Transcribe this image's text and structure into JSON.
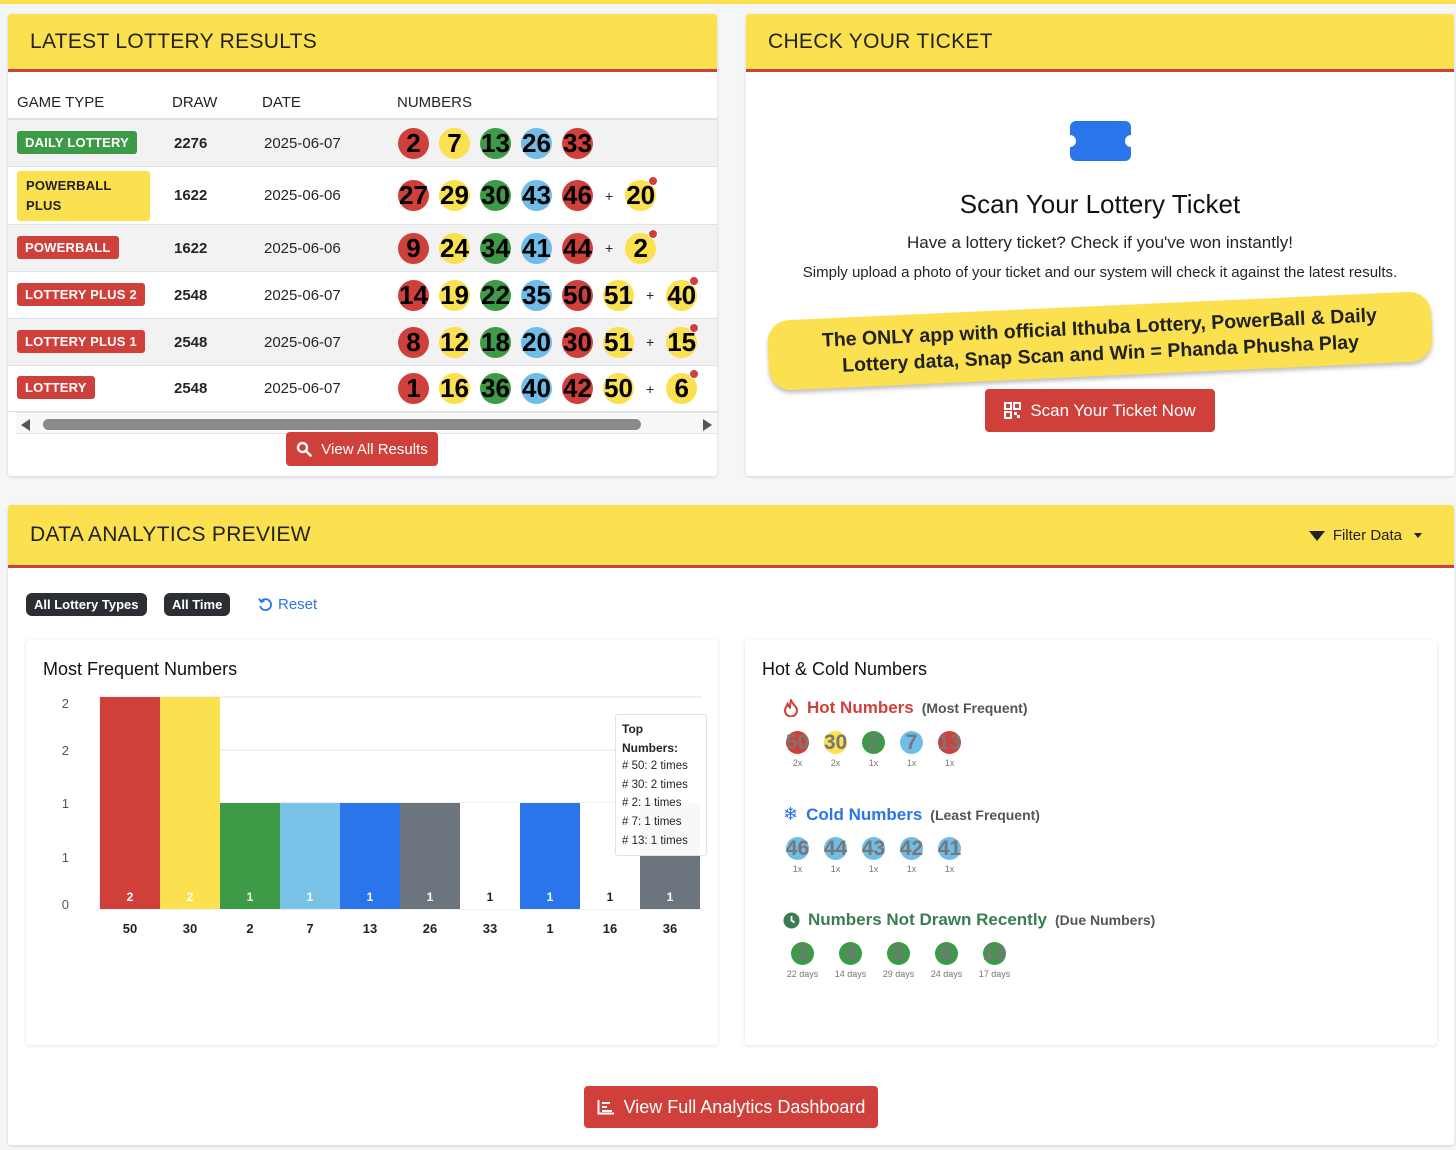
{
  "results": {
    "title": "LATEST LOTTERY RESULTS",
    "columns": [
      "GAME TYPE",
      "DRAW",
      "DATE",
      "NUMBERS"
    ],
    "rows": [
      {
        "game": "DAILY LOTTERY",
        "badge_color": "#3d9a47",
        "draw": "2276",
        "date": "2025-06-07",
        "numbers": [
          "2",
          "7",
          "13",
          "26",
          "33"
        ],
        "colors": [
          "red",
          "yellow",
          "green",
          "blue",
          "red"
        ],
        "bonus": ""
      },
      {
        "game": "POWERBALL PLUS",
        "badge_color": "#fbe04f",
        "draw": "1622",
        "date": "2025-06-06",
        "numbers": [
          "27",
          "29",
          "30",
          "43",
          "46"
        ],
        "colors": [
          "red",
          "yellow",
          "green",
          "blue",
          "red"
        ],
        "bonus": "20"
      },
      {
        "game": "POWERBALL",
        "badge_color": "#d0403a",
        "draw": "1622",
        "date": "2025-06-06",
        "numbers": [
          "9",
          "24",
          "34",
          "41",
          "44"
        ],
        "colors": [
          "red",
          "yellow",
          "green",
          "blue",
          "red"
        ],
        "bonus": "2"
      },
      {
        "game": "LOTTERY PLUS 2",
        "badge_color": "#d0403a",
        "draw": "2548",
        "date": "2025-06-07",
        "numbers": [
          "14",
          "19",
          "22",
          "35",
          "50",
          "51"
        ],
        "colors": [
          "red",
          "yellow",
          "green",
          "blue",
          "red",
          "yellow"
        ],
        "bonus": "40"
      },
      {
        "game": "LOTTERY PLUS 1",
        "badge_color": "#d0403a",
        "draw": "2548",
        "date": "2025-06-07",
        "numbers": [
          "8",
          "12",
          "18",
          "20",
          "30",
          "51"
        ],
        "colors": [
          "red",
          "yellow",
          "green",
          "blue",
          "red",
          "yellow"
        ],
        "bonus": "15"
      },
      {
        "game": "LOTTERY",
        "badge_color": "#d0403a",
        "draw": "2548",
        "date": "2025-06-07",
        "numbers": [
          "1",
          "16",
          "36",
          "40",
          "42",
          "50"
        ],
        "colors": [
          "red",
          "yellow",
          "green",
          "blue",
          "red",
          "yellow"
        ],
        "bonus": "6"
      }
    ],
    "plus_sign": "+",
    "view_all_label": "View All Results"
  },
  "ticket": {
    "title": "CHECK YOUR TICKET",
    "heading": "Scan Your Lottery Ticket",
    "subtitle": "Have a lottery ticket? Check if you've won instantly!",
    "note": "Simply upload a photo of your ticket and our system will check it against the latest results.",
    "banner": "The ONLY app with official Ithuba Lottery, PowerBall & Daily Lottery data, Snap Scan and Win = Phanda Phusha Play",
    "scan_button": "Scan Your Ticket Now"
  },
  "analytics": {
    "title": "DATA ANALYTICS PREVIEW",
    "filter_label": "Filter Data",
    "filters": [
      "All Lottery Types",
      "All Time"
    ],
    "reset_label": "Reset",
    "most_frequent_title": "Most Frequent Numbers",
    "hot_cold_title": "Hot & Cold Numbers",
    "hot": {
      "label": "Hot Numbers",
      "note": "(Most Frequent)",
      "color": "#d0403a",
      "items": [
        {
          "n": "50",
          "c": "red",
          "t": "2x"
        },
        {
          "n": "30",
          "c": "yellow",
          "t": "2x"
        },
        {
          "n": "2",
          "c": "green",
          "t": "1x"
        },
        {
          "n": "7",
          "c": "blue",
          "t": "1x"
        },
        {
          "n": "13",
          "c": "red",
          "t": "1x"
        }
      ]
    },
    "cold": {
      "label": "Cold Numbers",
      "note": "(Least Frequent)",
      "color": "#2a75ea",
      "items": [
        {
          "n": "46",
          "c": "blue",
          "t": "1x"
        },
        {
          "n": "44",
          "c": "blue",
          "t": "1x"
        },
        {
          "n": "43",
          "c": "blue",
          "t": "1x"
        },
        {
          "n": "42",
          "c": "blue",
          "t": "1x"
        },
        {
          "n": "41",
          "c": "blue",
          "t": "1x"
        }
      ]
    },
    "due": {
      "label": "Numbers Not Drawn Recently",
      "note": "(Due Numbers)",
      "color": "#3a7d52",
      "items": [
        {
          "n": "3",
          "c": "green",
          "t": "22 days"
        },
        {
          "n": "4",
          "c": "green",
          "t": "14 days"
        },
        {
          "n": "5",
          "c": "green",
          "t": "29 days"
        },
        {
          "n": "6",
          "c": "green",
          "t": "24 days"
        },
        {
          "n": "10",
          "c": "green",
          "t": "17 days"
        }
      ]
    },
    "tooltip": {
      "title": "Top Numbers:",
      "lines": [
        "# 50: 2 times",
        "# 30: 2 times",
        "# 2: 1 times",
        "# 7: 1 times",
        "# 13: 1 times"
      ]
    },
    "dashboard_button": "View Full Analytics Dashboard"
  },
  "chart_data": {
    "type": "bar",
    "title": "Most Frequent Numbers",
    "categories": [
      "50",
      "30",
      "2",
      "7",
      "13",
      "26",
      "33",
      "1",
      "16",
      "36"
    ],
    "values": [
      2,
      2,
      1,
      1,
      1,
      1,
      1,
      1,
      1,
      1
    ],
    "colors": [
      "#d0403a",
      "#fbe04f",
      "#3d9a47",
      "#77c2e6",
      "#2a75ea",
      "#6c757d",
      "#ffffff",
      "#2a75ea",
      "#ffffff",
      "#6c757d"
    ],
    "ytick_labels": [
      "2",
      "2",
      "1",
      "1",
      "0"
    ],
    "ylim": [
      0,
      2
    ],
    "grid": true
  },
  "colors": {
    "yellow": "#fbe04f",
    "red": "#d0403a",
    "green": "#3d9a47",
    "blue": "#6fbce8"
  }
}
